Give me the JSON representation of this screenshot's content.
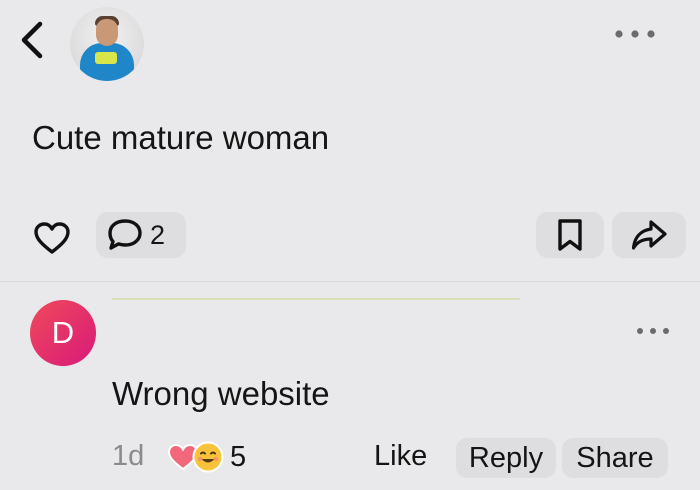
{
  "header": {
    "back_icon": "chevron-left-icon",
    "more_icon": "more-horizontal-icon"
  },
  "post": {
    "text": "Cute mature woman",
    "comment_count": "2",
    "icons": {
      "like": "heart-outline-icon",
      "comment": "speech-bubble-icon",
      "bookmark": "bookmark-icon",
      "share": "share-arrow-icon"
    }
  },
  "comment": {
    "avatar_letter": "D",
    "avatar_color": "#e8305f",
    "text": "Wrong website",
    "time": "1d",
    "reaction_count": "5",
    "reaction_icons": [
      "heart-icon",
      "smile-emoji-icon"
    ],
    "like_label": "Like",
    "reply_label": "Reply",
    "share_label": "Share"
  }
}
